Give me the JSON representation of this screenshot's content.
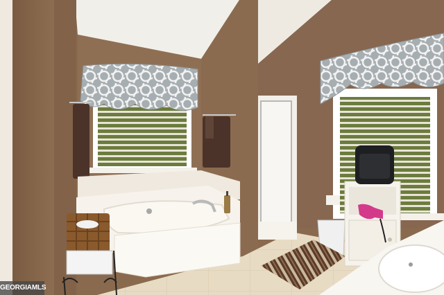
{
  "photo": {
    "subject": "bathroom",
    "colors": {
      "wall": "#8a6a4e",
      "ceiling": "#f1efe9",
      "window_frame": "#ffffff",
      "valance": "#9aa3a7",
      "tile": "#e9dcc6",
      "tub": "#fbf8f2"
    }
  },
  "watermark": {
    "text": "GEORGIAMLS"
  }
}
